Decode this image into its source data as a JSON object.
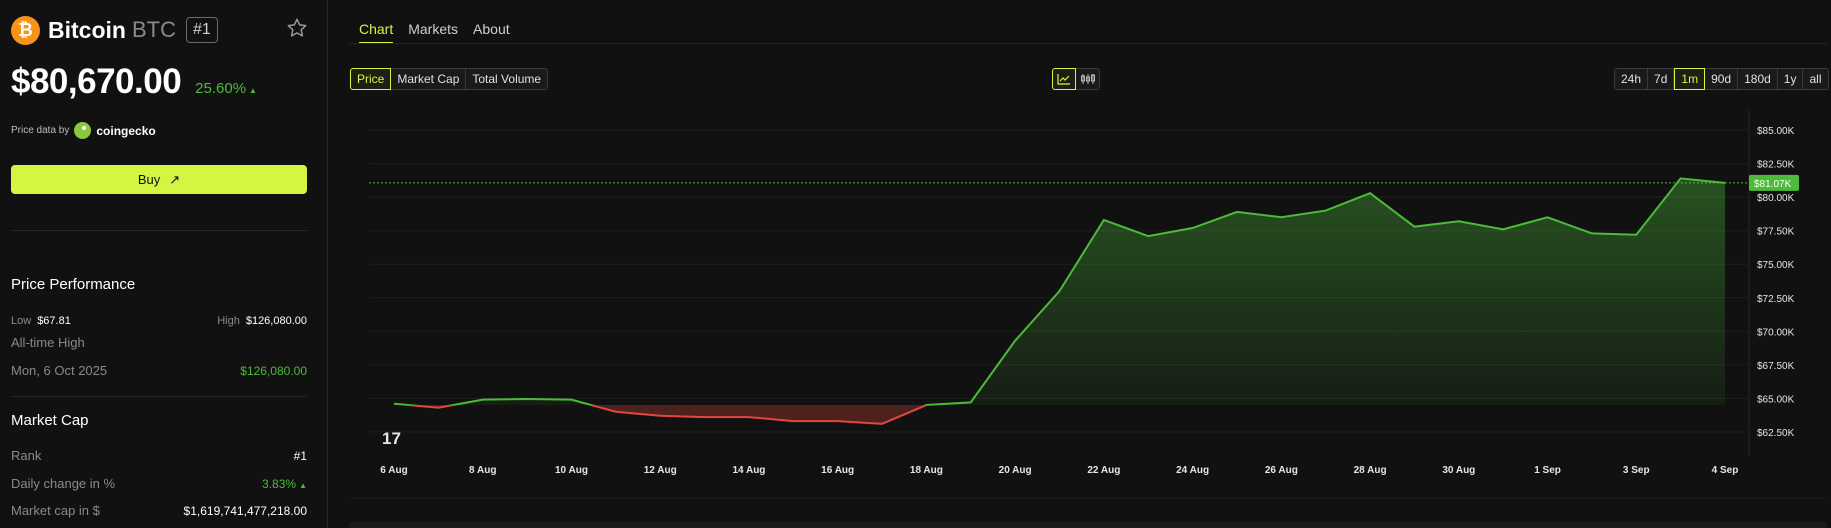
{
  "coin": {
    "name": "Bitcoin",
    "symbol": "BTC",
    "rank": "#1",
    "price": "$80,670.00",
    "change": "25.60%",
    "price_by_label": "Price data by",
    "provider": "coingecko",
    "buy_label": "Buy"
  },
  "performance": {
    "title": "Price Performance",
    "low_label": "Low",
    "low_value": "$67.81",
    "high_label": "High",
    "high_value": "$126,080.00",
    "ath_label": "All-time High",
    "ath_date": "Mon, 6 Oct 2025",
    "ath_value": "$126,080.00"
  },
  "market_cap": {
    "title": "Market Cap",
    "rank_label": "Rank",
    "rank_value": "#1",
    "daily_label": "Daily change in %",
    "daily_value": "3.83%",
    "cap_label": "Market cap in $",
    "cap_value": "$1,619,741,477,218.00"
  },
  "tabs": [
    {
      "label": "Chart",
      "active": true
    },
    {
      "label": "Markets",
      "active": false
    },
    {
      "label": "About",
      "active": false
    }
  ],
  "metric_tabs": [
    {
      "label": "Price",
      "active": true
    },
    {
      "label": "Market Cap",
      "active": false
    },
    {
      "label": "Total Volume",
      "active": false
    }
  ],
  "chart_type_icons": [
    "line-chart-icon",
    "candlestick-chart-icon"
  ],
  "ranges": [
    {
      "label": "24h",
      "active": false
    },
    {
      "label": "7d",
      "active": false
    },
    {
      "label": "1m",
      "active": true
    },
    {
      "label": "90d",
      "active": false
    },
    {
      "label": "180d",
      "active": false
    },
    {
      "label": "1y",
      "active": false
    },
    {
      "label": "all",
      "active": false
    }
  ],
  "colors": {
    "accent": "#d4f542",
    "up": "#4cbb3a",
    "down": "#e0483e",
    "btc": "#f7931a"
  },
  "chart_data": {
    "type": "area",
    "current_label": "$81.07K",
    "current_value": 81070,
    "baseline": 64500,
    "ylim": [
      60700,
      86500
    ],
    "y_ticks": [
      85000,
      82500,
      80000,
      77500,
      75000,
      72500,
      70000,
      67500,
      65000,
      62500
    ],
    "y_tick_labels": [
      "$85.00K",
      "$82.50K",
      "$80.00K",
      "$77.50K",
      "$75.00K",
      "$72.50K",
      "$70.00K",
      "$67.50K",
      "$65.00K",
      "$62.50K"
    ],
    "x_tick_labels": [
      "6 Aug",
      "8 Aug",
      "10 Aug",
      "12 Aug",
      "14 Aug",
      "16 Aug",
      "18 Aug",
      "20 Aug",
      "22 Aug",
      "24 Aug",
      "26 Aug",
      "28 Aug",
      "30 Aug",
      "1 Sep",
      "3 Sep",
      "4 Sep"
    ],
    "x": [
      0,
      1,
      2,
      3,
      4,
      5,
      6,
      7,
      8,
      9,
      10,
      11,
      12,
      13,
      14,
      15,
      16,
      17,
      18,
      19,
      20,
      21,
      22,
      23,
      24,
      25,
      26,
      27,
      28,
      29,
      30
    ],
    "values": [
      64600,
      64300,
      64900,
      64950,
      64900,
      64000,
      63700,
      63600,
      63600,
      63300,
      63300,
      63100,
      64500,
      64700,
      69300,
      73000,
      78300,
      77100,
      77700,
      78900,
      78500,
      79000,
      80300,
      77800,
      78200,
      77600,
      78500,
      77300,
      77200,
      81400,
      81070
    ]
  }
}
